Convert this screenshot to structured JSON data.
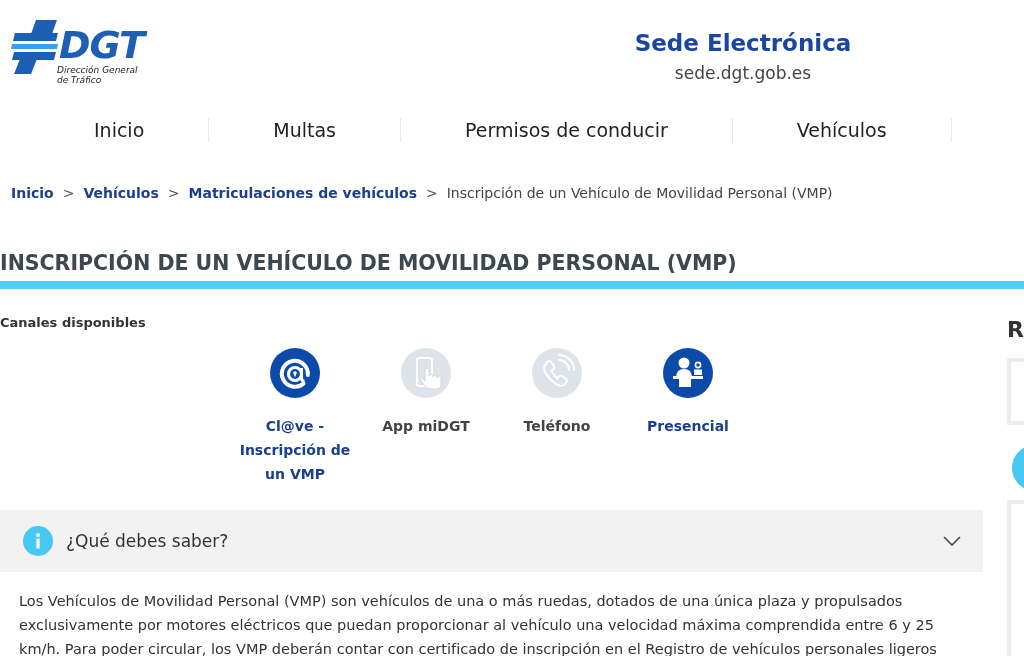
{
  "logo": {
    "wordmark": "DGT",
    "subtitle": "Dirección General de Tráfico"
  },
  "site": {
    "title": "Sede Electrónica",
    "url": "sede.dgt.gob.es"
  },
  "nav": [
    "Inicio",
    "Multas",
    "Permisos de conducir",
    "Vehículos"
  ],
  "breadcrumb": [
    {
      "kind": "link",
      "label": "Inicio"
    },
    {
      "kind": "separator",
      "label": ">"
    },
    {
      "kind": "link",
      "label": "Vehículos"
    },
    {
      "kind": "separator",
      "label": ">"
    },
    {
      "kind": "link",
      "label": "Matriculaciones de vehículos"
    },
    {
      "kind": "separator",
      "label": ">"
    },
    {
      "kind": "current",
      "label": "Inscripción de un Vehículo de Movilidad Personal (VMP)"
    }
  ],
  "page_title": "INSCRIPCIÓN DE UN VEHÍCULO DE MOVILIDAD PERSONAL (VMP)",
  "channels": {
    "heading": "Canales disponibles",
    "items": [
      {
        "kind": "web",
        "label": "Cl@ve - Inscripción de un VMP",
        "available": true
      },
      {
        "kind": "app",
        "label": "App miDGT",
        "available": false
      },
      {
        "kind": "phone",
        "label": "Teléfono",
        "available": false
      },
      {
        "kind": "office",
        "label": "Presencial",
        "available": true
      }
    ]
  },
  "accordion": {
    "title": "¿Qué debes saber?",
    "expanded": true,
    "body": "Los Vehículos de Movilidad Personal (VMP) son vehículos de una o más ruedas, dotados de una única plaza y propulsados exclusivamente por motores eléctricos que puedan proporcionar al vehículo una velocidad máxima comprendida entre 6 y 25 km/h. Para poder circular, los VMP deberán contar con certificado de inscripción en el Registro de vehículos personales ligeros"
  },
  "sidebar": {
    "heading": "R"
  }
}
